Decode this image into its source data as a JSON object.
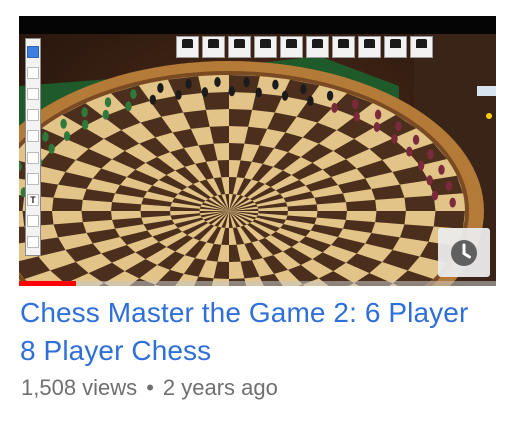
{
  "video": {
    "title": "Chess Master the Game 2: 6 Player 8 Player Chess",
    "views": "1,508 views",
    "separator": "•",
    "age": "2 years ago",
    "progress_fraction": 0.12
  },
  "thumbnail": {
    "left_toolbar_icons": [
      "hand-icon",
      "pencil-icon",
      "paint-icon",
      "stamp-icon",
      "line-icon",
      "eraser-icon",
      "marker-icon",
      "text-icon",
      "arrow-icon",
      "figure-icon"
    ],
    "left_toolbar_glyphs": [
      "",
      "",
      "",
      "",
      "",
      "",
      "",
      "T",
      "",
      ""
    ],
    "top_toolbar_icons": [
      "undo-icon",
      "piece-icon",
      "grid-icon",
      "rotate-icon",
      "board-icon",
      "player-icon",
      "flag-icon",
      "list-icon",
      "close-icon",
      "counter-icon"
    ]
  },
  "watch_later": {
    "icon": "clock-icon"
  },
  "colors": {
    "title": "#2f6fd8",
    "meta": "#6f6f6f",
    "progress": "#ff0000"
  }
}
